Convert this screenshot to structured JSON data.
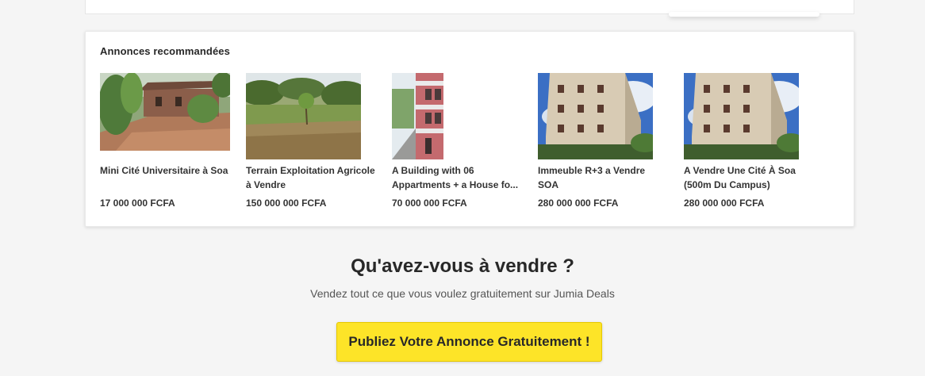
{
  "recommended": {
    "title": "Annonces recommandées",
    "listings": [
      {
        "title": "Mini Cité Universitaire à Soa",
        "price": "17 000 000 FCFA",
        "image": "house-photo"
      },
      {
        "title": "Terrain Exploitation Agricole",
        "title_line2": "à Vendre",
        "price": "150 000 000 FCFA",
        "image": "land-photo"
      },
      {
        "title": "A Building with 06",
        "title_line2": "Appartments + a House fo...",
        "price": "70 000 000 FCFA",
        "image": "building-photo"
      },
      {
        "title": "Immeuble R+3 a Vendre",
        "title_line2": "SOA",
        "price": "280 000 000 FCFA",
        "image": "apartment-block-photo"
      },
      {
        "title": "A Vendre Une Cité À Soa",
        "title_line2": "(500m Du Campus)",
        "price": "280 000 000 FCFA",
        "image": "apartment-block-photo"
      }
    ]
  },
  "sell": {
    "title": "Qu'avez-vous à vendre ?",
    "subtitle": "Vendez tout ce que vous voulez gratuitement sur Jumia Deals",
    "button_label": "Publiez Votre Annonce Gratuitement !"
  },
  "colors": {
    "button_yellow": "#fde428",
    "page_background": "#f5f5f5",
    "card_background": "#ffffff"
  }
}
